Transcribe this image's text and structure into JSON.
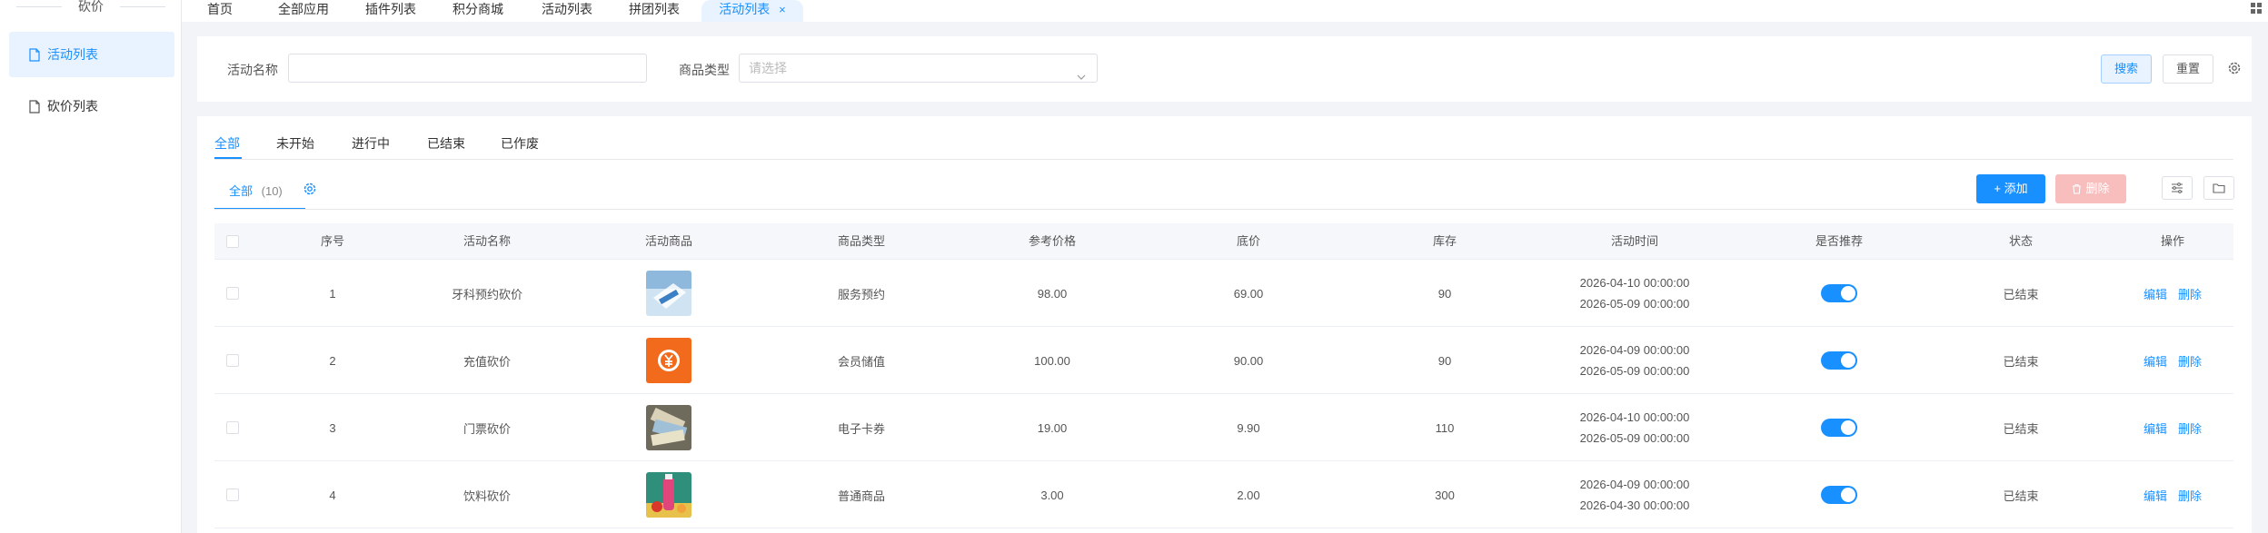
{
  "colors": {
    "accent": "#1890ff",
    "accent_light": "#e8f3ff",
    "danger_disabled": "#f8bdbd",
    "toggle_on": "#1890ff"
  },
  "sidebar": {
    "title": "砍价",
    "items": [
      {
        "label": "活动列表",
        "icon": "document-icon",
        "active": true
      },
      {
        "label": "砍价列表",
        "icon": "document-icon",
        "active": false
      }
    ]
  },
  "top_tabs": [
    {
      "label": "首页"
    },
    {
      "label": "全部应用"
    },
    {
      "label": "插件列表"
    },
    {
      "label": "积分商城"
    },
    {
      "label": "活动列表"
    },
    {
      "label": "拼团列表"
    },
    {
      "label": "活动列表",
      "active": true,
      "close": "×"
    }
  ],
  "search": {
    "name_label": "活动名称",
    "name_value": "",
    "type_label": "商品类型",
    "type_placeholder": "请选择",
    "search_button": "搜索",
    "reset_button": "重置"
  },
  "status_tabs": [
    "全部",
    "未开始",
    "进行中",
    "已结束",
    "已作废"
  ],
  "sub_tab": {
    "label": "全部",
    "count": "(10)"
  },
  "toolbar": {
    "add_label": "+ 添加",
    "delete_label": "删除"
  },
  "table": {
    "columns": [
      "序号",
      "活动名称",
      "活动商品",
      "商品类型",
      "参考价格",
      "底价",
      "库存",
      "活动时间",
      "是否推荐",
      "状态",
      "操作"
    ],
    "rows": [
      {
        "no": "1",
        "name": "牙科预约砍价",
        "image": "dental-product-image",
        "type": "服务预约",
        "ref_price": "98.00",
        "base_price": "69.00",
        "stock": "90",
        "start": "2026-04-10 00:00:00",
        "end": "2026-05-09 00:00:00",
        "recommended": true,
        "status": "已结束",
        "edit": "编辑",
        "delete": "删除"
      },
      {
        "no": "2",
        "name": "充值砍价",
        "image": "yuan-coin-product-image",
        "type": "会员储值",
        "ref_price": "100.00",
        "base_price": "90.00",
        "stock": "90",
        "start": "2026-04-09 00:00:00",
        "end": "2026-05-09 00:00:00",
        "recommended": true,
        "status": "已结束",
        "edit": "编辑",
        "delete": "删除"
      },
      {
        "no": "3",
        "name": "门票砍价",
        "image": "tickets-product-image",
        "type": "电子卡券",
        "ref_price": "19.00",
        "base_price": "9.90",
        "stock": "110",
        "start": "2026-04-10 00:00:00",
        "end": "2026-05-09 00:00:00",
        "recommended": true,
        "status": "已结束",
        "edit": "编辑",
        "delete": "删除"
      },
      {
        "no": "4",
        "name": "饮料砍价",
        "image": "drink-product-image",
        "type": "普通商品",
        "ref_price": "3.00",
        "base_price": "2.00",
        "stock": "300",
        "start": "2026-04-09 00:00:00",
        "end": "2026-04-30 00:00:00",
        "recommended": true,
        "status": "已结束",
        "edit": "编辑",
        "delete": "删除"
      }
    ]
  }
}
